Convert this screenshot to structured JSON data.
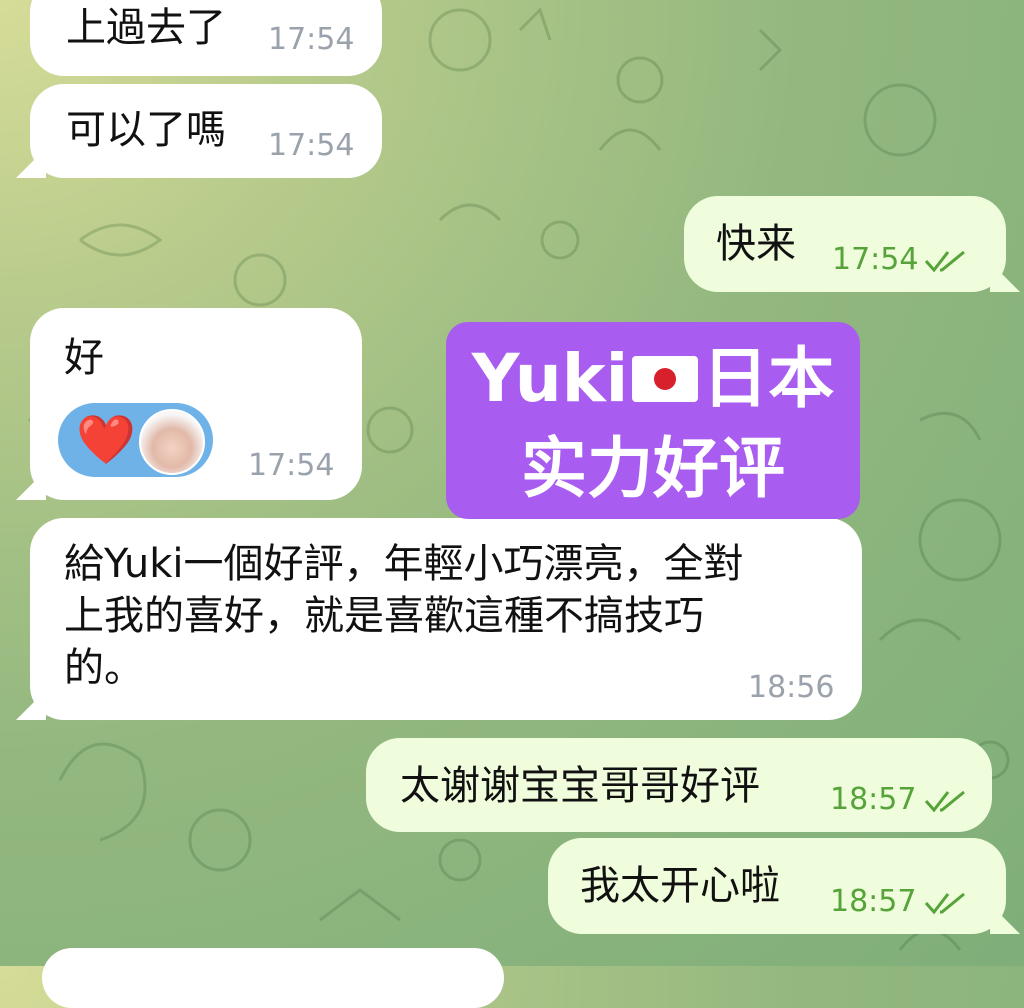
{
  "messages": [
    {
      "id": "m1",
      "side": "in",
      "text": "上過去了",
      "time": "17:54"
    },
    {
      "id": "m2",
      "side": "in",
      "text": "可以了嗎",
      "time": "17:54"
    },
    {
      "id": "m3",
      "side": "out",
      "text": "快来",
      "time": "17:54"
    },
    {
      "id": "m4",
      "side": "in",
      "text": "好",
      "time": "17:54",
      "reaction": {
        "emoji": "❤️"
      }
    },
    {
      "id": "m5",
      "side": "in",
      "text": "給Yuki一個好評，年輕小巧漂亮，全對\n上我的喜好，就是喜歡這種不搞技巧\n的。",
      "time": "18:56"
    },
    {
      "id": "m6",
      "side": "out",
      "text": "太谢谢宝宝哥哥好评",
      "time": "18:57"
    },
    {
      "id": "m7",
      "side": "out",
      "text": "我太开心啦",
      "time": "18:57"
    }
  ],
  "overlay": {
    "line1_prefix": "Yuki",
    "line1_suffix": "日本",
    "line2": "实力好评",
    "bg_color": "#a95cf0"
  },
  "colors": {
    "incoming_bubble": "#ffffff",
    "outgoing_bubble": "#effddc",
    "read_check": "#56a33a"
  }
}
